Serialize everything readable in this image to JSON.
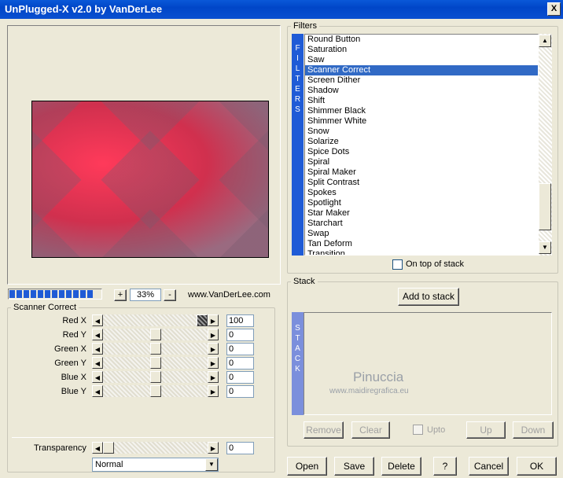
{
  "window": {
    "title": "UnPlugged-X v2.0 by VanDerLee",
    "close": "X"
  },
  "preview": {
    "zoom": "33%",
    "plus": "+",
    "minus": "-",
    "website": "www.VanDerLee.com",
    "progress_blocks": 12
  },
  "scanner": {
    "title": "Scanner Correct",
    "sliders": [
      {
        "label": "Red X",
        "value": "100",
        "level": 1.0
      },
      {
        "label": "Red Y",
        "value": "0",
        "level": 0.5
      },
      {
        "label": "Green X",
        "value": "0",
        "level": 0.5
      },
      {
        "label": "Green Y",
        "value": "0",
        "level": 0.5
      },
      {
        "label": "Blue X",
        "value": "0",
        "level": 0.5
      },
      {
        "label": "Blue Y",
        "value": "0",
        "level": 0.5
      }
    ],
    "transparency": {
      "label": "Transparency",
      "value": "0",
      "level": 0.0
    },
    "blend": "Normal"
  },
  "filters": {
    "title": "Filters",
    "strip": "FILTERS",
    "items": [
      "Round Button",
      "Saturation",
      "Saw",
      "Scanner Correct",
      "Screen Dither",
      "Shadow",
      "Shift",
      "Shimmer Black",
      "Shimmer White",
      "Snow",
      "Solarize",
      "Spice Dots",
      "Spiral",
      "Spiral Maker",
      "Split Contrast",
      "Spokes",
      "Spotlight",
      "Star Maker",
      "Starchart",
      "Swap",
      "Tan Deform",
      "Transition"
    ],
    "selected": "Scanner Correct",
    "on_top": "On top of stack"
  },
  "stack": {
    "title": "Stack",
    "strip": "STACK",
    "add": "Add to stack",
    "remove": "Remove",
    "clear": "Clear",
    "upto": "Upto",
    "up": "Up",
    "down": "Down"
  },
  "watermark": {
    "name": "Pinuccia",
    "url": "www.maidiregrafica.eu"
  },
  "footer": {
    "open": "Open",
    "save": "Save",
    "delete": "Delete",
    "help": "?",
    "cancel": "Cancel",
    "ok": "OK"
  }
}
